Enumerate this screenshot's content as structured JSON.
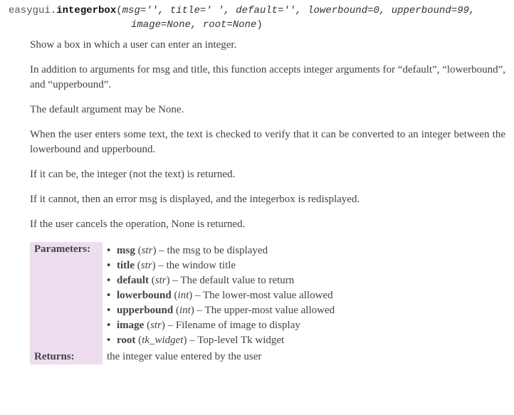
{
  "signature": {
    "module": "easygui.",
    "name": "integerbox",
    "params_line1": "msg='', title=' ', default='', lowerbound=0, upperbound=99,",
    "params_line2": "image=None, root=None",
    "paren_open": "(",
    "paren_close": ")"
  },
  "description": {
    "p1": "Show a box in which a user can enter an integer.",
    "p2": "In addition to arguments for msg and title, this function accepts integer arguments for “default”, “lowerbound”, and “upperbound”.",
    "p3": "The default argument may be None.",
    "p4": "When the user enters some text, the text is checked to verify that it can be converted to an integer between the lowerbound and upperbound.",
    "p5": "If it can be, the integer (not the text) is returned.",
    "p6": "If it cannot, then an error msg is displayed, and the integerbox is redisplayed.",
    "p7": "If the user cancels the operation, None is returned."
  },
  "fields": {
    "parameters_label": "Parameters:",
    "returns_label": "Returns:",
    "params": [
      {
        "name": "msg",
        "type": "str",
        "desc": "the msg to be displayed"
      },
      {
        "name": "title",
        "type": "str",
        "desc": "the window title"
      },
      {
        "name": "default",
        "type": "str",
        "desc": "The default value to return"
      },
      {
        "name": "lowerbound",
        "type": "int",
        "desc": "The lower-most value allowed"
      },
      {
        "name": "upperbound",
        "type": "int",
        "desc": "The upper-most value allowed"
      },
      {
        "name": "image",
        "type": "str",
        "desc": "Filename of image to display"
      },
      {
        "name": "root",
        "type": "tk_widget",
        "desc": "Top-level Tk widget"
      }
    ],
    "returns": "the integer value entered by the user"
  }
}
